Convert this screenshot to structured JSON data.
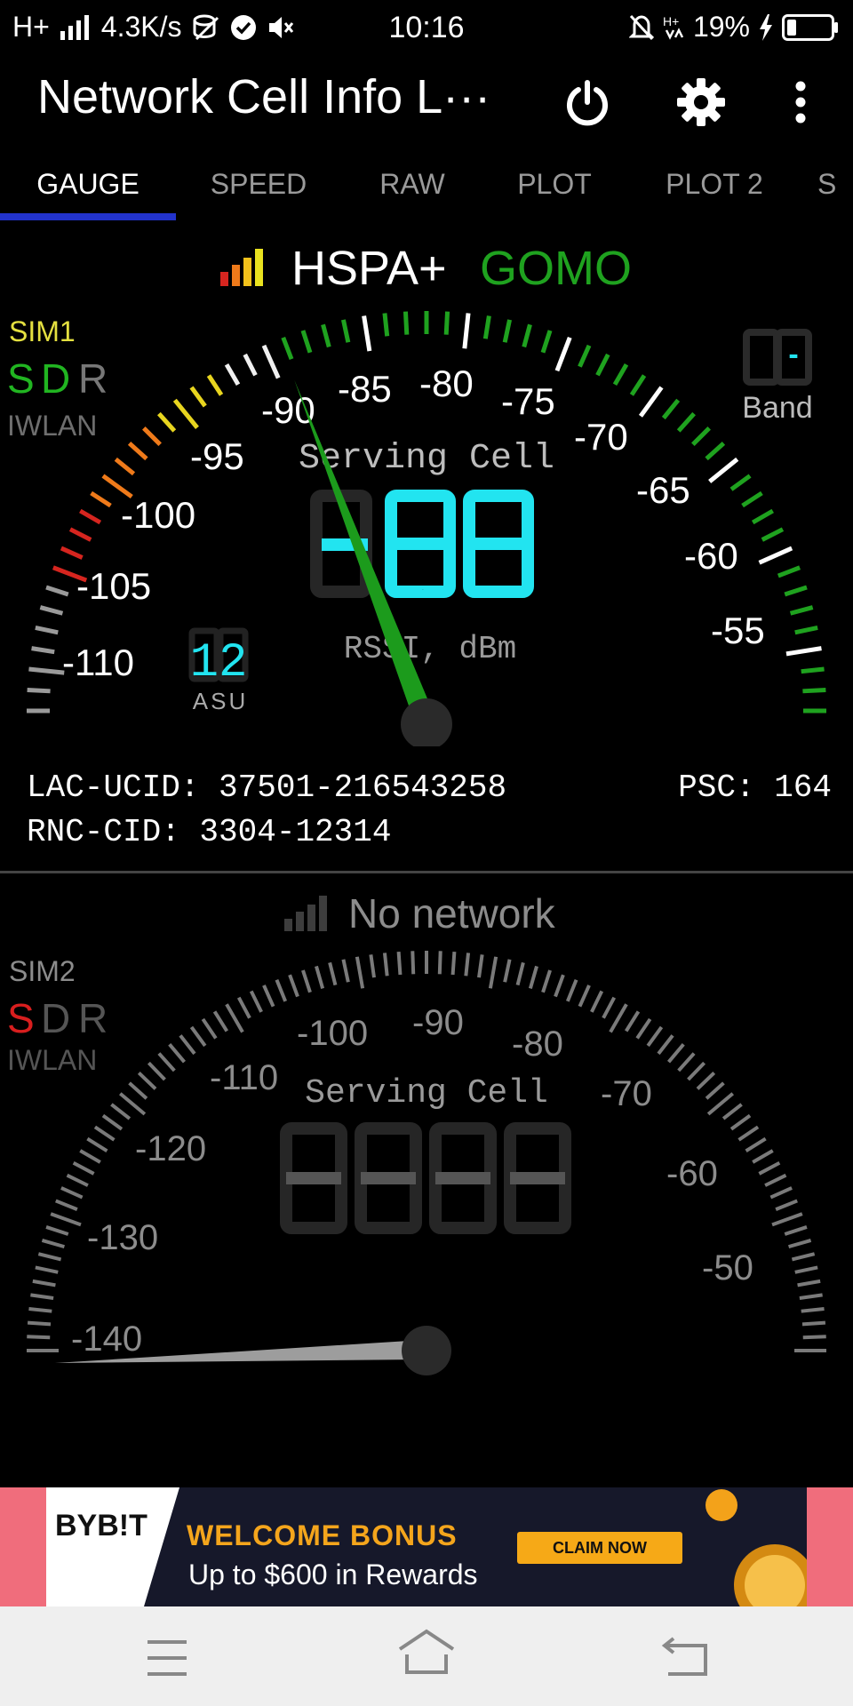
{
  "status_bar": {
    "network_type": "H+",
    "speed": "4.3K/s",
    "time": "10:16",
    "battery": "19%"
  },
  "app_bar": {
    "title": "Network Cell Info L···",
    "icons": [
      "power-icon",
      "gear-icon",
      "more-vert-icon"
    ]
  },
  "tabs": [
    "GAUGE",
    "SPEED",
    "RAW",
    "PLOT",
    "PLOT 2",
    "S"
  ],
  "sim1": {
    "label": "SIM1",
    "letters": {
      "s": "S",
      "d": "D",
      "r": "R"
    },
    "iwlan": "IWLAN",
    "technology": "HSPA+",
    "operator": "GOMO",
    "band_label": "Band",
    "band_value": "-",
    "serving_cell": "Serving Cell",
    "value": "-89",
    "value_digits": "89",
    "unit": "RSSI, dBm",
    "asu": "12",
    "asu_label": "ASU",
    "scale": [
      "-110",
      "-105",
      "-100",
      "-95",
      "-90",
      "-85",
      "-80",
      "-75",
      "-70",
      "-65",
      "-60",
      "-55"
    ],
    "lac_ucid": "LAC-UCID: 37501-216543258",
    "rnc_cid": "RNC-CID: 3304-12314",
    "psc": "PSC: 164",
    "colors": {
      "good": "#1fa21f",
      "operator": "#1fa21f",
      "sim_label": "#e4e040",
      "lcd": "#22e4f0"
    }
  },
  "sim2": {
    "label": "SIM2",
    "letters": {
      "s": "S",
      "d": "D",
      "r": "R"
    },
    "iwlan": "IWLAN",
    "status": "No network",
    "serving_cell": "Serving Cell",
    "scale": [
      "-140",
      "-130",
      "-120",
      "-110",
      "-100",
      "-90",
      "-80",
      "-70",
      "-60",
      "-50"
    ],
    "colors": {
      "s_letter": "#d81e1e"
    }
  },
  "ad": {
    "brand": "BYB!T",
    "headline": "WELCOME BONUS",
    "subline": "Up to $600 in Rewards",
    "cta": "CLAIM NOW"
  },
  "nav_bar": {
    "icons": [
      "menu-icon",
      "home-icon",
      "back-icon"
    ]
  }
}
